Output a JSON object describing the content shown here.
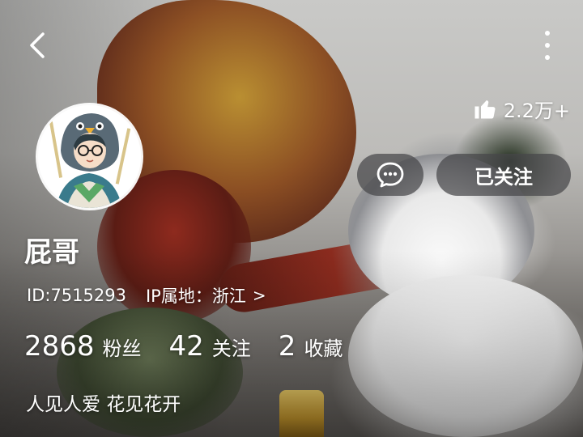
{
  "header": {
    "back_icon": "chevron-left-icon",
    "more_icon": "vertical-dots-icon"
  },
  "likes": {
    "icon": "thumbs-up-icon",
    "count": "2.2万+"
  },
  "actions": {
    "message_icon": "chat-bubble-icon",
    "follow_label": "已关注"
  },
  "profile": {
    "nickname": "屁哥",
    "user_id": "ID:7515293",
    "ip_location": "IP属地：浙江",
    "ip_chevron": ">",
    "bio": "人见人爱 花见花开"
  },
  "stats": [
    {
      "value": "2868",
      "label": "粉丝"
    },
    {
      "value": "42",
      "label": "关注"
    },
    {
      "value": "2",
      "label": "收藏"
    }
  ],
  "colors": {
    "button_bg": "#46464a",
    "text": "#ffffff"
  }
}
